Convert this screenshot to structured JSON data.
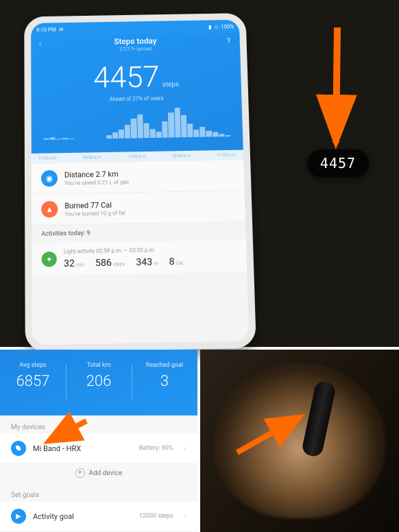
{
  "status_bar": {
    "time": "9:10 PM",
    "battery": "100%"
  },
  "hero": {
    "title": "Steps today",
    "subtitle": "27217+ synced",
    "count": "4457",
    "unit": "steps",
    "ahead": "Ahead of 27% of users",
    "times": [
      "12:00 a.m.",
      "06:00 a.m.",
      "12:00 p.m.",
      "06:00 p.m.",
      "11:59 p.m."
    ],
    "bars": [
      2,
      3,
      1,
      2,
      1,
      0,
      0,
      0,
      0,
      0,
      5,
      8,
      12,
      18,
      26,
      32,
      20,
      12,
      8,
      22,
      34,
      40,
      30,
      18,
      10,
      14,
      8,
      6,
      4,
      2
    ]
  },
  "distance": {
    "title": "Distance 2.7 km",
    "subtitle": "You've saved 0.21 L of gas"
  },
  "burned": {
    "title": "Burned 77 Cal",
    "subtitle": "You've burned 10 g of fat"
  },
  "activities": {
    "header": "Activities today:  9",
    "light_time": "Light activity 02:58 p.m. — 03:30 p.m.",
    "mins": "32",
    "mins_u": "min",
    "steps": "586",
    "steps_u": "steps",
    "dist": "343",
    "dist_u": "m",
    "cal": "8",
    "cal_u": "Cal"
  },
  "tracker_display": "4457",
  "stats": {
    "avg_label": "Avg steps",
    "avg": "6857",
    "km_label": "Total km",
    "km": "206",
    "goal_label": "Reached goal",
    "goal": "3"
  },
  "sections": {
    "devices": "My devices",
    "goals": "Set goals"
  },
  "device": {
    "name": "Mi Band - HRX",
    "battery": "Battery: 90%"
  },
  "add_device": "Add device",
  "goal": {
    "name": "Activity goal",
    "value": "12000 steps"
  }
}
